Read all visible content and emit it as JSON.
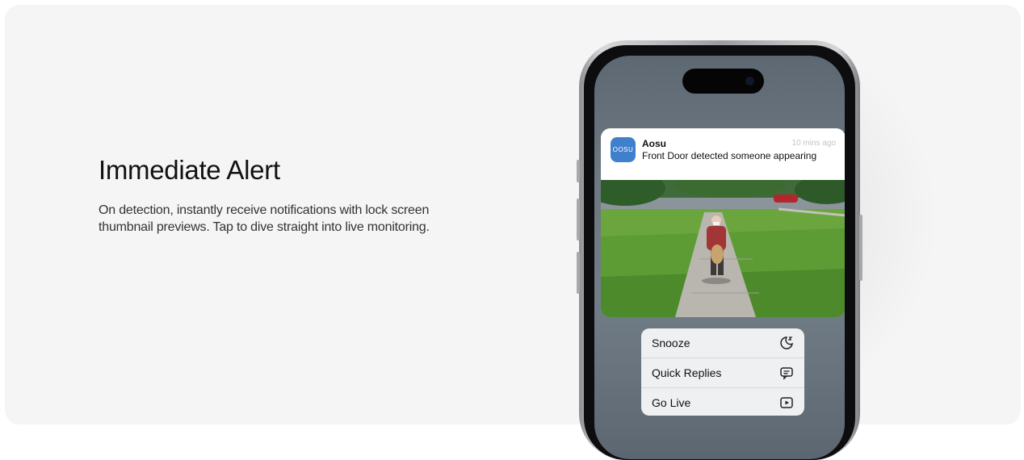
{
  "feature": {
    "title": "Immediate Alert",
    "description": "On detection, instantly receive notifications with lock screen thumbnail previews. Tap to dive straight into live monitoring."
  },
  "notification": {
    "app_icon_text": "OOSU",
    "app_name": "Aosu",
    "time": "10 mins ago",
    "message": "Front Door detected someone appearing"
  },
  "actions": [
    {
      "label": "Snooze",
      "icon": "snooze-moon-icon"
    },
    {
      "label": "Quick Replies",
      "icon": "chat-bubble-icon"
    },
    {
      "label": "Go Live",
      "icon": "play-video-icon"
    }
  ]
}
